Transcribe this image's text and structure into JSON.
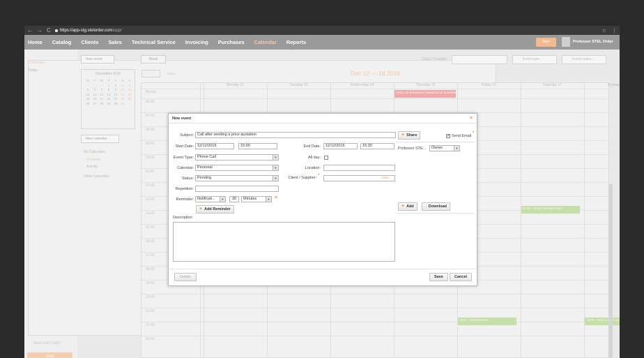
{
  "browser": {
    "url_scheme": "https://",
    "url_host": "app-stg.stelorder.com",
    "url_path": "/app/",
    "star_icon": "star-icon",
    "menu_icon": "kebab-menu-icon"
  },
  "menubar": {
    "items": [
      "Home",
      "Catalog",
      "Clients",
      "Sales",
      "Technical Service",
      "Invoicing",
      "Purchases",
      "Calendar",
      "Reports"
    ],
    "active": "Calendar",
    "start_label": "Start",
    "user_name": "Professor STEL Order"
  },
  "sidebar": {
    "calendar_link": "Calendar",
    "tasks_link": "Tasks",
    "need_help": "Need some help?",
    "chat_label": "Chat",
    "book_label": "Hire, Share & Rank"
  },
  "left_panel": {
    "new_event": "New event",
    "month_title": "December 2016",
    "weekdays": [
      "M",
      "T",
      "W",
      "T",
      "F",
      "S",
      "S"
    ],
    "days": [
      "",
      "",
      "",
      "1",
      "2",
      "3",
      "4",
      "5",
      "6",
      "7",
      "8",
      "9",
      "10",
      "11",
      "12",
      "13",
      "14",
      "15",
      "16",
      "17",
      "18",
      "19",
      "20",
      "21",
      "22",
      "23",
      "24",
      "25",
      "26",
      "27",
      "28",
      "29",
      "30",
      "31",
      ""
    ],
    "new_calendar": "New calendar",
    "my_calendars": "My Calendars",
    "cal_personal": "Personal",
    "cal_activity": "Activity",
    "other_calendars": "Other Calendars"
  },
  "toolbar": {
    "week": "Week",
    "client_supplier": "Client / Supplier:",
    "event_type": "Event type...",
    "event_status": "Event status...",
    "range": "Dec 12 — 18 2016",
    "today": "Today"
  },
  "calendar": {
    "days": [
      "Monday 12",
      "Tuesday 13",
      "Wednesday 14",
      "Thursday 15",
      "Friday 16",
      "Saturday 17",
      "Sunday 18"
    ],
    "times": [
      "All-day",
      "06:00",
      "07:00",
      "08:00",
      "09:00",
      "10:00",
      "11:00",
      "12:00",
      "13:00",
      "14:00",
      "15:00",
      "16:00",
      "17:00",
      "18:00",
      "19:00",
      "20:00",
      "21:00",
      "22:00",
      "23:00"
    ],
    "events": [
      "Carry out preventive maintenance operation",
      "11:30 - 12:30 Visit with client",
      "18:00 - Send invoice",
      "18:00 - Send a price quote - Order"
    ],
    "colors": {
      "allday": "#f0a9a9",
      "green": "#c5dfa9"
    }
  },
  "modal": {
    "title": "New event",
    "close_icon": "close-icon",
    "subject_label": "Subject:",
    "subject_value": "Call after sending a price quotation",
    "share_label": "Share",
    "send_email_label": "Send Email",
    "start_label": "Start Date:",
    "start_date": "12/12/2016",
    "start_time": "15:00",
    "end_label": "End Date:",
    "end_date": "12/12/2016",
    "end_time": "15:30",
    "etype_label": "Event Type:",
    "etype_value": "Phone Call",
    "allday_label": "All day:",
    "calendar_label": "Calendar:",
    "calendar_value": "Personal",
    "location_label": "Location:",
    "status_label": "Status:",
    "status_value": "Pending",
    "client_label": "Client / Supplier:",
    "view_label": "View",
    "repetition_label": "Repetition:",
    "reminder_label": "Reminder:",
    "reminder_type": "Notificati...",
    "reminder_amount": "30",
    "reminder_unit": "Minutes",
    "add_reminder_label": "Add Reminder",
    "description_label": "Description:",
    "attendee_name": "Professor STE...",
    "attendee_role": "Owner",
    "add_label": "Add",
    "download_label": "Download",
    "delete_label": "Delete",
    "save_label": "Save",
    "cancel_label": "Cancel"
  }
}
